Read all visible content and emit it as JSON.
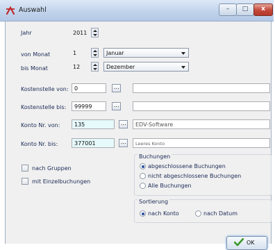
{
  "window": {
    "title": "Auswahl",
    "minimize_glyph": "–",
    "maximize_glyph": "□",
    "close_glyph": "x"
  },
  "form": {
    "jahr": {
      "label": "Jahr",
      "value": "2011"
    },
    "von_monat": {
      "label": "von Monat",
      "value": "1",
      "month": "Januar"
    },
    "bis_monat": {
      "label": "bis Monat",
      "value": "12",
      "month": "Dezember"
    },
    "kostenstelle_von": {
      "label": "Kostenstelle von:",
      "value": "0",
      "name": ""
    },
    "kostenstelle_bis": {
      "label": "Kostenstelle bis:",
      "value": "99999",
      "name": ""
    },
    "konto_von": {
      "label": "Konto Nr. von:",
      "value": "135",
      "name": "EDV-Software"
    },
    "konto_bis": {
      "label": "Konto Nr. bis:",
      "value": "377001",
      "name": "Leeres Konto"
    },
    "ellipsis_glyph": "…"
  },
  "checkboxes": {
    "nach_gruppen": "nach Gruppen",
    "mit_einzelbuchungen": "mit Einzelbuchungen"
  },
  "buchungen": {
    "title": "Buchungen",
    "options": [
      "abgeschlossene Buchungen",
      "nicht abgeschlossene Buchungen",
      "Alle Buchungen"
    ],
    "selected": 0
  },
  "sortierung": {
    "title": "Sortierung",
    "options": [
      "nach Konto",
      "nach Datum"
    ],
    "selected": 0
  },
  "buttons": {
    "ok": "OK"
  },
  "colors": {
    "highlight_field": "#e6f9fb",
    "close_button": "#c2483a",
    "ok_check": "#3a9a2a",
    "app_icon": "#c0282a"
  },
  "icons": {
    "app": "app-icon",
    "ok": "checkmark-icon"
  }
}
